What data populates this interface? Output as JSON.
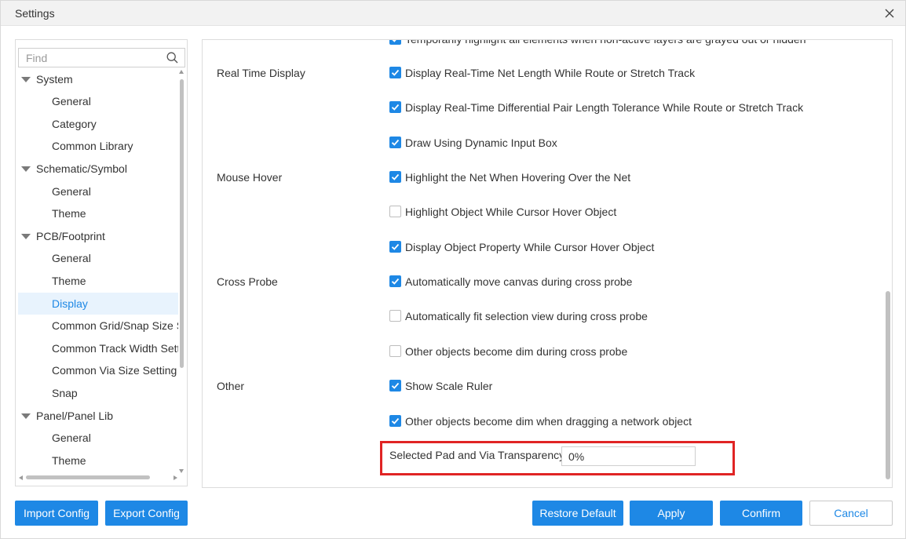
{
  "window": {
    "title": "Settings"
  },
  "search": {
    "placeholder": "Find"
  },
  "tree": [
    {
      "label": "System",
      "level": 0
    },
    {
      "label": "General",
      "level": 1
    },
    {
      "label": "Category",
      "level": 1
    },
    {
      "label": "Common Library",
      "level": 1
    },
    {
      "label": "Schematic/Symbol",
      "level": 0
    },
    {
      "label": "General",
      "level": 1
    },
    {
      "label": "Theme",
      "level": 1
    },
    {
      "label": "PCB/Footprint",
      "level": 0
    },
    {
      "label": "General",
      "level": 1
    },
    {
      "label": "Theme",
      "level": 1
    },
    {
      "label": "Display",
      "level": 1,
      "selected": true
    },
    {
      "label": "Common Grid/Snap Size Setting",
      "level": 1
    },
    {
      "label": "Common Track Width Setting",
      "level": 1
    },
    {
      "label": "Common Via Size Setting",
      "level": 1
    },
    {
      "label": "Snap",
      "level": 1
    },
    {
      "label": "Panel/Panel Lib",
      "level": 0
    },
    {
      "label": "General",
      "level": 1
    },
    {
      "label": "Theme",
      "level": 1
    }
  ],
  "groups": {
    "real_time": "Real Time Display",
    "mouse_hover": "Mouse Hover",
    "cross_probe": "Cross Probe",
    "other": "Other"
  },
  "options": {
    "temp_highlight": {
      "label": "Temporarily highlight all elements when non-active layers are grayed out or hidden",
      "checked": true
    },
    "rt_net_length": {
      "label": "Display Real-Time Net Length While Route or Stretch Track",
      "checked": true
    },
    "rt_diff_pair": {
      "label": "Display Real-Time Differential Pair Length Tolerance While Route or Stretch Track",
      "checked": true
    },
    "dynamic_input": {
      "label": "Draw Using Dynamic Input Box",
      "checked": true
    },
    "hover_net": {
      "label": "Highlight the Net When Hovering Over the Net",
      "checked": true
    },
    "hover_object": {
      "label": "Highlight Object While Cursor Hover Object",
      "checked": false
    },
    "hover_property": {
      "label": "Display Object Property While Cursor Hover Object",
      "checked": true
    },
    "cp_move_canvas": {
      "label": "Automatically move canvas during cross probe",
      "checked": true
    },
    "cp_fit_view": {
      "label": "Automatically fit selection view during cross probe",
      "checked": false
    },
    "cp_dim": {
      "label": "Other objects become dim during cross probe",
      "checked": false
    },
    "scale_ruler": {
      "label": "Show Scale Ruler",
      "checked": true
    },
    "drag_dim": {
      "label": "Other objects become dim when dragging a network object",
      "checked": true
    }
  },
  "transparency": {
    "label": "Selected Pad and Via Transparency",
    "value": "0%"
  },
  "buttons": {
    "import": "Import Config",
    "export": "Export Config",
    "restore": "Restore Default",
    "apply": "Apply",
    "confirm": "Confirm",
    "cancel": "Cancel"
  },
  "colors": {
    "accent": "#1e88e5",
    "highlight": "#e02424",
    "selected_bg": "#e8f3fd"
  }
}
